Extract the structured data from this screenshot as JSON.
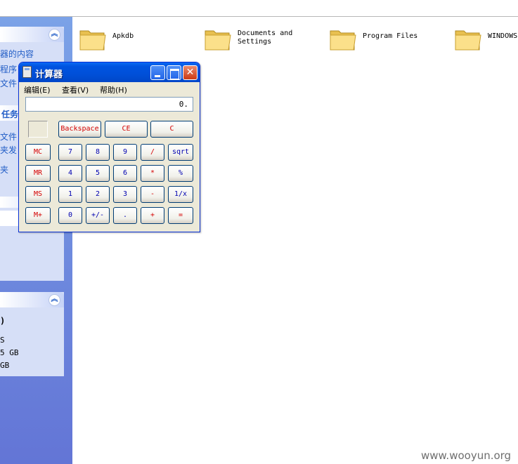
{
  "task_pane": {
    "box1": {
      "link1": "器的内容",
      "link2": "程序",
      "link3": "文件"
    },
    "box2": {
      "title": "任务",
      "link1": "文件",
      "link2": "夹发",
      "link3": "夹"
    },
    "box3": {
      "line1": ")",
      "line2": "S",
      "line3": "5 GB",
      "line4": "GB"
    }
  },
  "folders": [
    {
      "label": "Apkdb"
    },
    {
      "label": "Documents and\nSettings"
    },
    {
      "label": "Program Files"
    },
    {
      "label": "WINDOWS"
    }
  ],
  "calculator": {
    "title": "计算器",
    "menu": [
      "编辑(E)",
      "查看(V)",
      "帮助(H)"
    ],
    "display": "0.",
    "top_buttons": [
      "Backspace",
      "CE",
      "C"
    ],
    "memory_buttons": [
      "MC",
      "MR",
      "MS",
      "M+"
    ],
    "rows": [
      [
        "7",
        "8",
        "9",
        "/",
        "sqrt"
      ],
      [
        "4",
        "5",
        "6",
        "*",
        "%"
      ],
      [
        "1",
        "2",
        "3",
        "-",
        "1/x"
      ],
      [
        "0",
        "+/-",
        ".",
        "+",
        "="
      ]
    ]
  },
  "watermark": "www.wooyun.org",
  "colors": {
    "title_bar": "#0050d8",
    "red_label": "#d40000",
    "blue_label": "#0000b0",
    "task_pane_bg": "#6f8de0"
  },
  "icons": [
    "chevron-up-icon",
    "folder-icon",
    "calculator-app-icon",
    "minimize-icon",
    "maximize-icon",
    "close-icon"
  ]
}
